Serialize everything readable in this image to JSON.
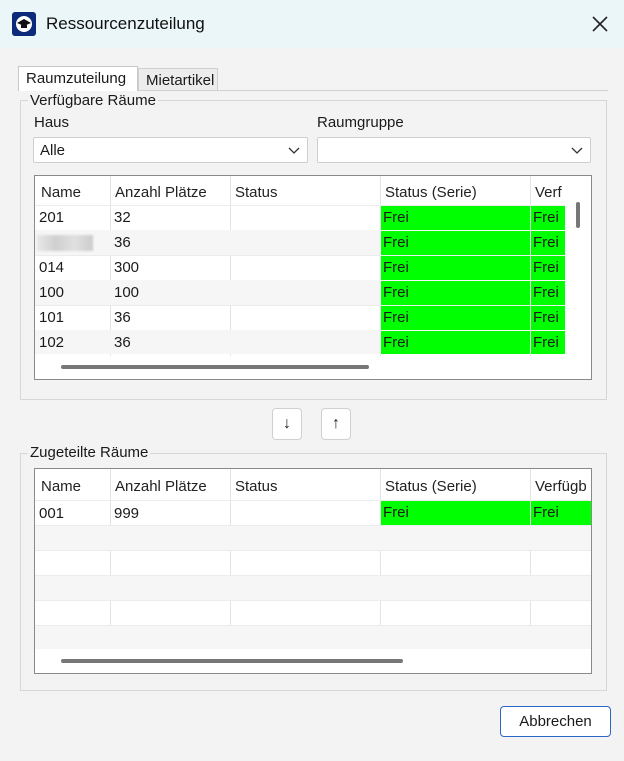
{
  "window": {
    "title": "Ressourcenzuteilung",
    "close_glyph": "✕"
  },
  "tabs": [
    {
      "label": "Raumzuteilung"
    },
    {
      "label": "Mietartikel"
    }
  ],
  "available": {
    "group_label": "Verfügbare Räume",
    "haus_label": "Haus",
    "haus_value": "Alle",
    "raumgruppe_label": "Raumgruppe",
    "raumgruppe_value": "",
    "columns": [
      "Name",
      "Anzahl Plätze",
      "Status",
      "Status (Serie)",
      "Verf"
    ],
    "rows": [
      {
        "name": "201",
        "plaetze": "32",
        "status": "",
        "status_serie": "Frei",
        "verf": "Frei"
      },
      {
        "name": "",
        "plaetze": "36",
        "status": "",
        "status_serie": "Frei",
        "verf": "Frei"
      },
      {
        "name": "014",
        "plaetze": "300",
        "status": "",
        "status_serie": "Frei",
        "verf": "Frei"
      },
      {
        "name": "100",
        "plaetze": "100",
        "status": "",
        "status_serie": "Frei",
        "verf": "Frei"
      },
      {
        "name": "101",
        "plaetze": "36",
        "status": "",
        "status_serie": "Frei",
        "verf": "Frei"
      },
      {
        "name": "102",
        "plaetze": "36",
        "status": "",
        "status_serie": "Frei",
        "verf": "Frei"
      }
    ]
  },
  "move": {
    "down_glyph": "↓",
    "up_glyph": "↑"
  },
  "assigned": {
    "group_label": "Zugeteilte Räume",
    "columns": [
      "Name",
      "Anzahl Plätze",
      "Status",
      "Status (Serie)",
      "Verfügb"
    ],
    "rows": [
      {
        "name": "001",
        "plaetze": "999",
        "status": "",
        "status_serie": "Frei",
        "verf": "Frei"
      }
    ]
  },
  "footer": {
    "cancel_label": "Abbrechen"
  },
  "colors": {
    "status_free": "#00ff00",
    "accent": "#2b67c7",
    "title_bar": "#eaf6f8"
  }
}
